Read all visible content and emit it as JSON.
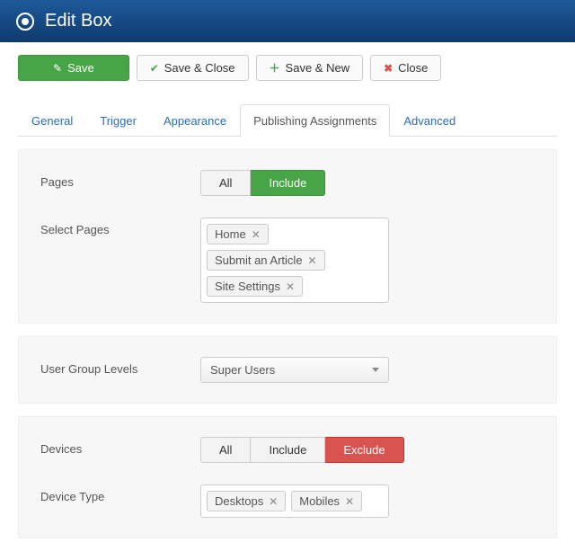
{
  "header": {
    "title": "Edit Box"
  },
  "toolbar": {
    "save": "Save",
    "save_close": "Save & Close",
    "save_new": "Save & New",
    "close": "Close"
  },
  "tabs": {
    "general": "General",
    "trigger": "Trigger",
    "appearance": "Appearance",
    "publishing": "Publishing Assignments",
    "advanced": "Advanced",
    "active": "publishing"
  },
  "panels": {
    "pages": {
      "label": "Pages",
      "options": {
        "all": "All",
        "include": "Include"
      },
      "active": "include",
      "select_label": "Select Pages",
      "selected": [
        "Home",
        "Submit an Article",
        "Site Settings"
      ]
    },
    "usergroups": {
      "label": "User Group Levels",
      "value": "Super Users"
    },
    "devices": {
      "label": "Devices",
      "options": {
        "all": "All",
        "include": "Include",
        "exclude": "Exclude"
      },
      "active": "exclude",
      "type_label": "Device Type",
      "selected": [
        "Desktops",
        "Mobiles"
      ]
    }
  }
}
